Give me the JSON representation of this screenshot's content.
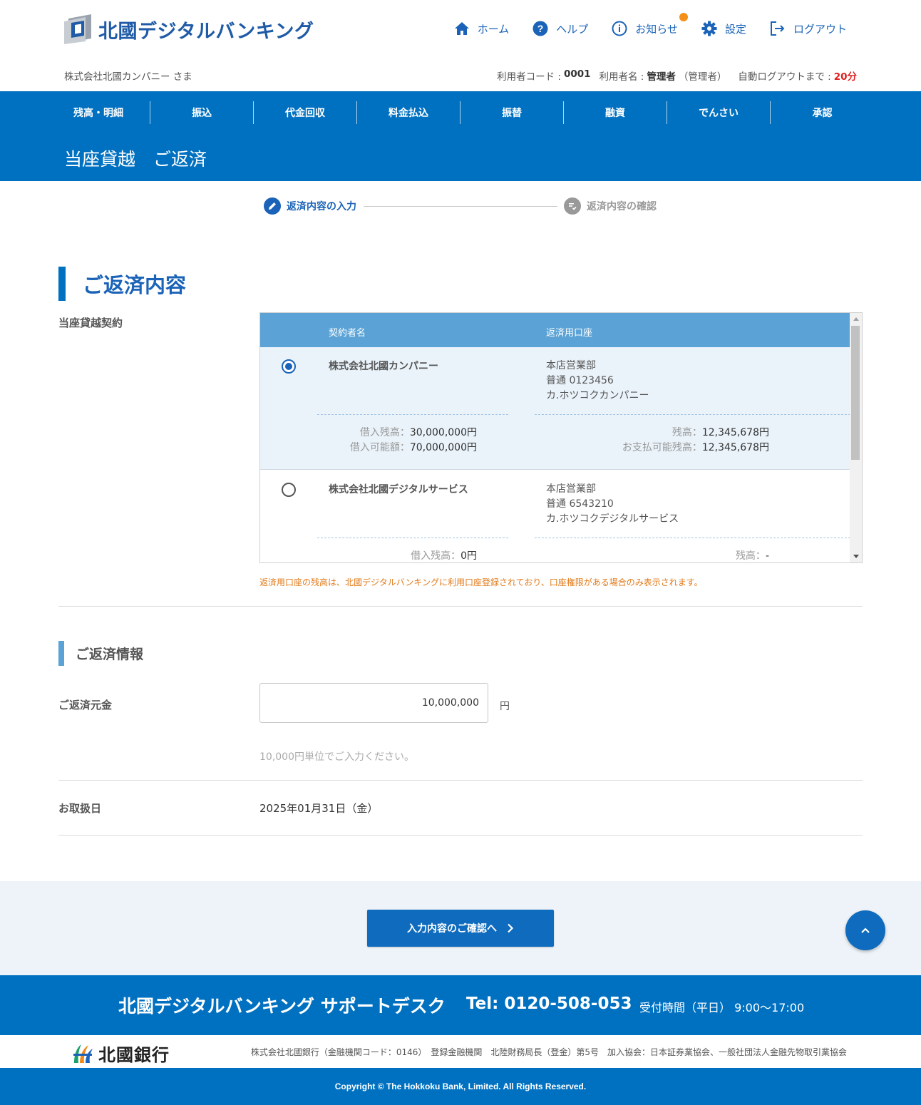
{
  "header": {
    "logo_text": "北國デジタルバンキング",
    "nav": [
      {
        "label": "ホーム",
        "icon": "home-icon"
      },
      {
        "label": "ヘルプ",
        "icon": "help-icon"
      },
      {
        "label": "お知らせ",
        "icon": "info-icon"
      },
      {
        "label": "設定",
        "icon": "gear-icon"
      },
      {
        "label": "ログアウト",
        "icon": "logout-icon"
      }
    ],
    "company": "株式会社北國カンパニー さま",
    "user_code_label": "利用者コード :",
    "user_code": "0001",
    "user_name_label": "利用者名 :",
    "user_name": "管理者",
    "user_role": "（管理者）",
    "auto_logout_label": "自動ログアウトまで :",
    "auto_logout": "20分"
  },
  "main_nav": [
    "残高・明細",
    "振込",
    "代金回収",
    "料金払込",
    "振替",
    "融資",
    "でんさい",
    "承認"
  ],
  "page_title": "当座貸越　ご返済",
  "stepper": {
    "step1": "返済内容の入力",
    "step2": "返済内容の確認"
  },
  "section": {
    "title": "ご返済内容",
    "contract_label": "当座貸越契約",
    "table": {
      "col1": "契約者名",
      "col2": "返済用口座",
      "rows": [
        {
          "selected": true,
          "name": "株式会社北國カンパニー",
          "branch": "本店営業部",
          "account": "普通 0123456",
          "holder": "カ.ホツコクカンパニー",
          "loan_balance_label": "借入残高：",
          "loan_balance": "30,000,000円",
          "loan_available_label": "借入可能額：",
          "loan_available": "70,000,000円",
          "balance_label": "残高：",
          "balance": "12,345,678円",
          "payable_label": "お支払可能残高：",
          "payable": "12,345,678円"
        },
        {
          "selected": false,
          "name": "株式会社北國デジタルサービス",
          "branch": "本店営業部",
          "account": "普通 6543210",
          "holder": "カ.ホツコクデジタルサービス",
          "loan_balance_label": "借入残高：",
          "loan_balance": "0円",
          "balance_label": "残高：",
          "balance": "-"
        }
      ]
    },
    "note": "返済用口座の残高は、北國デジタルバンキングに利用口座登録されており、口座権限がある場合のみ表示されます。"
  },
  "repay_info": {
    "title": "ご返済情報",
    "principal_label": "ご返済元金",
    "principal_value": "10,000,000",
    "yen": "円",
    "hint": "10,000円単位でご入力ください。",
    "date_label": "お取扱日",
    "date_value": "2025年01月31日（金）"
  },
  "actions": {
    "confirm_label": "入力内容のご確認へ"
  },
  "footer": {
    "support_title": "北國デジタルバンキング サポートデスク",
    "tel": "Tel: 0120-508-053",
    "hours": "受付時間（平日） 9:00〜17:00",
    "bank_name": "北國銀行",
    "bank_info": "株式会社北國銀行（金融機関コード：0146）　登録金融機関　北陸財務局長（登金）第5号　加入協会：日本証券業協会、一般社団法人金融先物取引業協会",
    "copyright": "Copyright © The Hokkoku Bank, Limited. All Rights Reserved."
  },
  "colors": {
    "primary": "#0071c1",
    "header_table": "#5ba3d6",
    "notice_dot": "#f39019",
    "warning_text": "#e27a1a",
    "logout_timer": "#e02020"
  }
}
